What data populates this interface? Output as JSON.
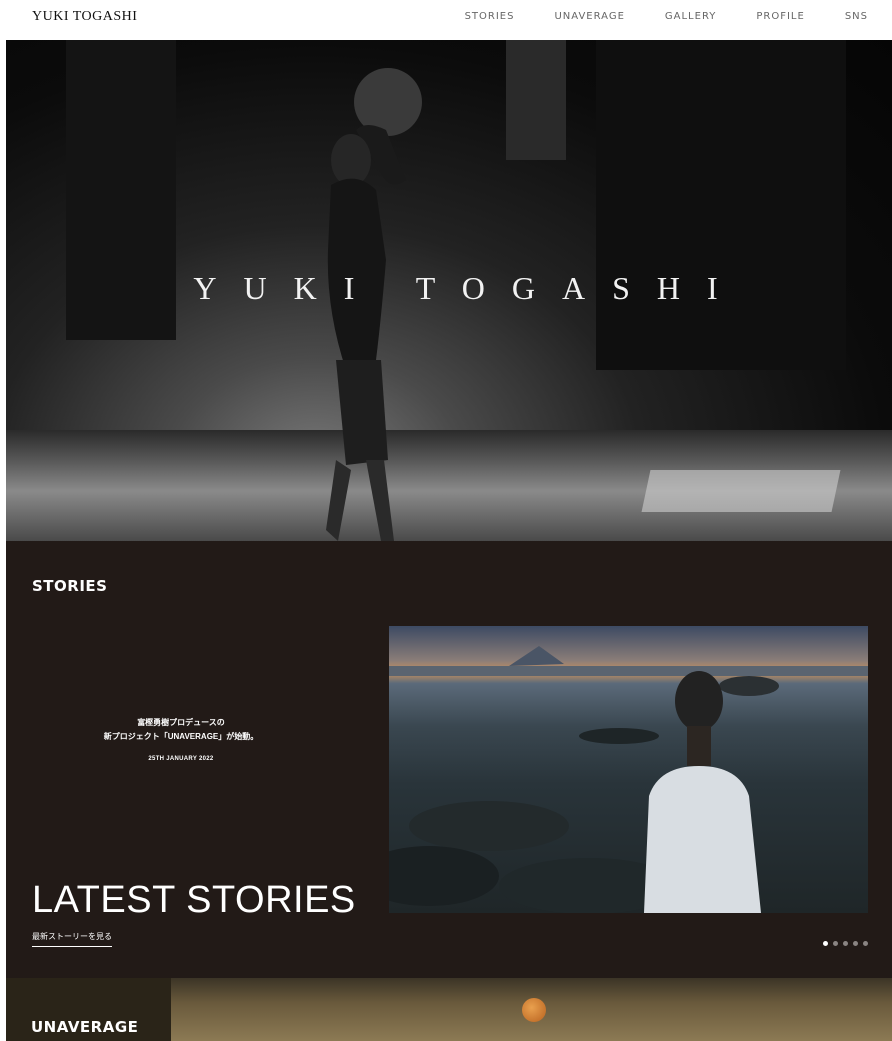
{
  "header": {
    "logo": "YUKI TOGASHI",
    "nav": [
      "STORIES",
      "UNAVERAGE",
      "GALLERY",
      "PROFILE",
      "SNS"
    ]
  },
  "hero": {
    "title": "YUKI TOGASHI"
  },
  "stories": {
    "heading": "STORIES",
    "story": {
      "line1": "富樫勇樹プロデュースの",
      "line2": "新プロジェクト「UNAVERAGE」が始動。",
      "date": "25TH JANUARY 2022"
    },
    "latest_title": "LATEST STORIES",
    "latest_link": "最新ストーリーを見る",
    "pagination": {
      "count": 5,
      "active": 1
    }
  },
  "unaverage": {
    "heading": "UNAVERAGE"
  },
  "colors": {
    "stories_bg": "#221a17",
    "accent_ball": "#e9a04e"
  }
}
